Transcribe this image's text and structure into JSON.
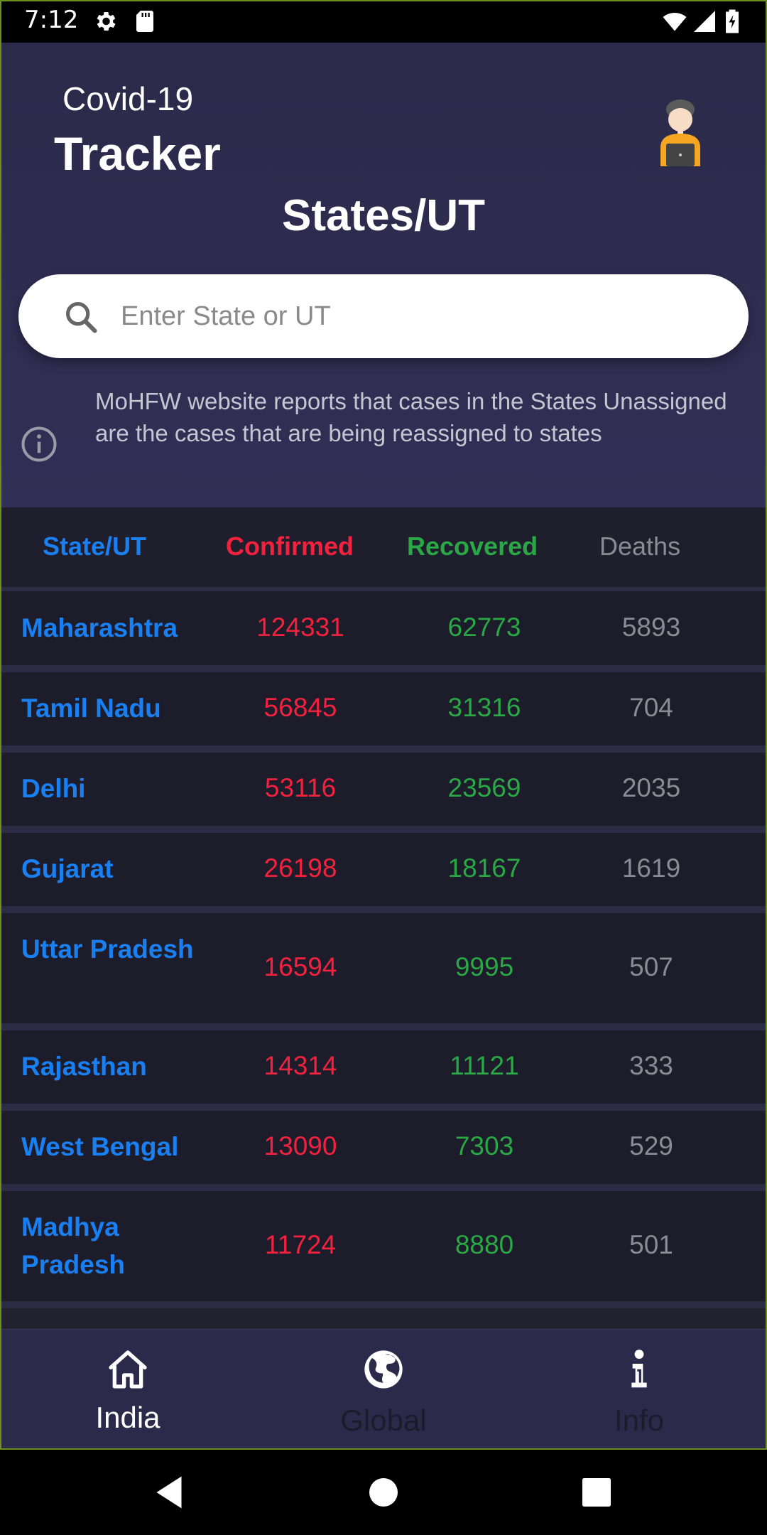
{
  "status_bar": {
    "time": "7:12"
  },
  "header": {
    "app_title_small": "Covid-19",
    "app_title_big": "Tracker",
    "page_title": "States/UT",
    "search_placeholder": "Enter State or UT",
    "search_value": "",
    "notice": "MoHFW website reports that cases in the States Unassigned are the cases that are being reassigned to states"
  },
  "colors": {
    "state": "#1a7ff0",
    "confirmed": "#f2223f",
    "recovered": "#29a845",
    "deaths": "#8b8b95",
    "background": "#2c2a4a",
    "table_bg": "#1d1c2b"
  },
  "table": {
    "headers": {
      "state": "State/UT",
      "confirmed": "Confirmed",
      "recovered": "Recovered",
      "deaths": "Deaths"
    },
    "rows": [
      {
        "state": "Maharashtra",
        "confirmed": "124331",
        "recovered": "62773",
        "deaths": "5893"
      },
      {
        "state": "Tamil Nadu",
        "confirmed": "56845",
        "recovered": "31316",
        "deaths": "704"
      },
      {
        "state": "Delhi",
        "confirmed": "53116",
        "recovered": "23569",
        "deaths": "2035"
      },
      {
        "state": "Gujarat",
        "confirmed": "26198",
        "recovered": "18167",
        "deaths": "1619"
      },
      {
        "state": "Uttar Pradesh",
        "confirmed": "16594",
        "recovered": "9995",
        "deaths": "507"
      },
      {
        "state": "Rajasthan",
        "confirmed": "14314",
        "recovered": "11121",
        "deaths": "333"
      },
      {
        "state": "West Bengal",
        "confirmed": "13090",
        "recovered": "7303",
        "deaths": "529"
      },
      {
        "state": "Madhya Pradesh",
        "confirmed": "11724",
        "recovered": "8880",
        "deaths": "501"
      }
    ]
  },
  "bottom_nav": {
    "items": [
      {
        "label": "India",
        "icon": "home-icon",
        "active": true
      },
      {
        "label": "Global",
        "icon": "globe-icon",
        "active": false
      },
      {
        "label": "Info",
        "icon": "info-icon",
        "active": false
      }
    ]
  },
  "system_nav": {
    "buttons": [
      "back-icon",
      "home-circle-icon",
      "recents-icon"
    ]
  }
}
